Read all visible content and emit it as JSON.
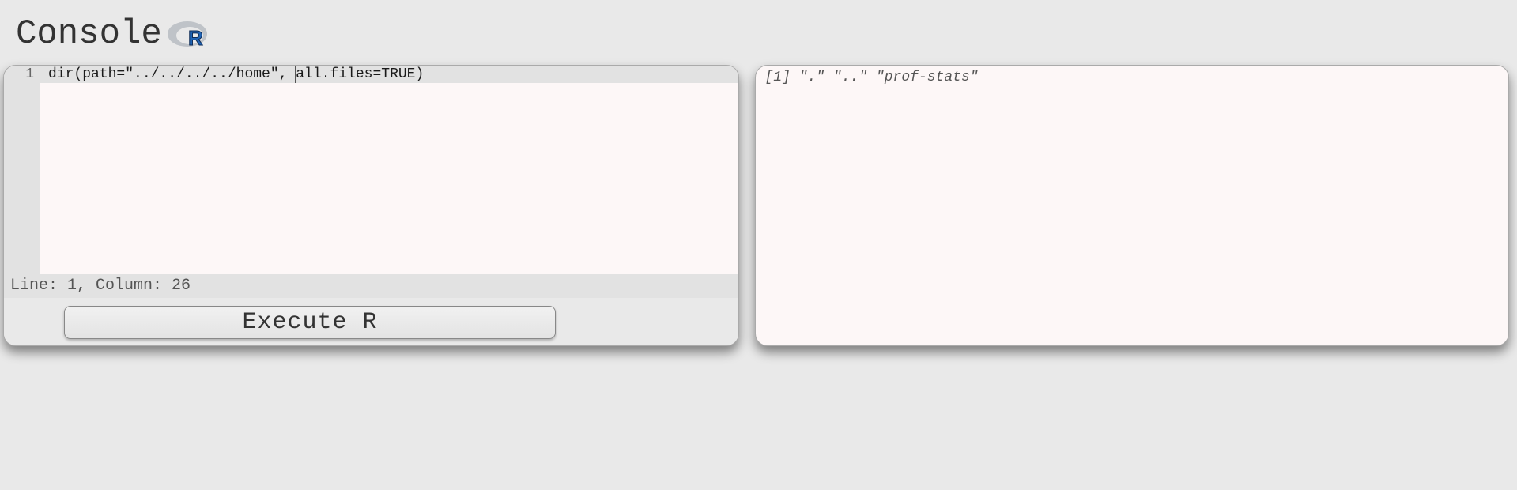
{
  "header": {
    "title": "Console"
  },
  "editor": {
    "line_number": "1",
    "code": "dir(path=\"../../../../home\", all.files=TRUE)",
    "status": "Line: 1, Column: 26"
  },
  "buttons": {
    "execute_label": "Execute R"
  },
  "output": {
    "text": "[1] \".\" \"..\" \"prof-stats\""
  }
}
